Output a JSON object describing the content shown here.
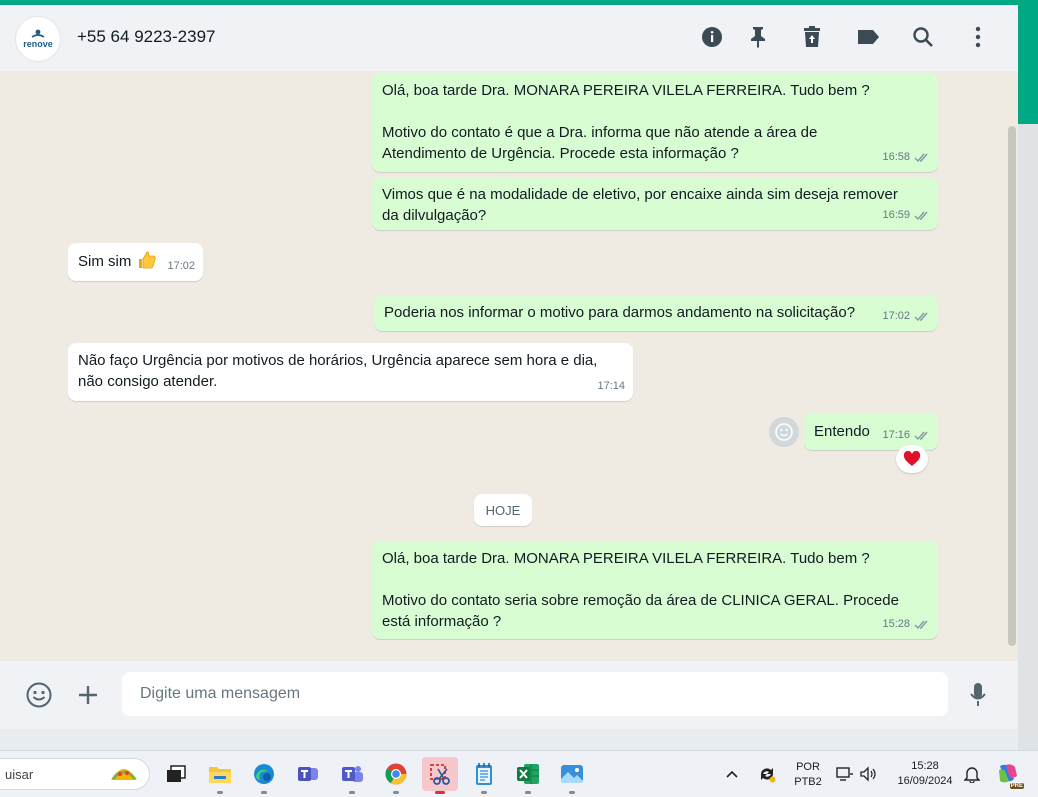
{
  "header": {
    "logo_text": "renove",
    "contact": "+55 64 9223-2397",
    "icons": [
      "info-icon",
      "pin-icon",
      "delete-icon",
      "label-icon",
      "search-icon",
      "menu-icon"
    ]
  },
  "messages": [
    {
      "dir": "out",
      "text": "Olá, boa tarde Dra. MONARA PEREIRA VILELA FERREIRA. Tudo bem ?\n\nMotivo do contato é que a Dra. informa que não atende a área de\nAtendimento de Urgência. Procede esta informação ?",
      "time": "16:58"
    },
    {
      "dir": "out",
      "text": "Vimos que é na modalidade de eletivo, por encaixe ainda sim deseja remover\nda dilvulgação?",
      "time": "16:59"
    },
    {
      "dir": "in",
      "text": "Sim sim",
      "time": "17:02"
    },
    {
      "dir": "out",
      "text": "Poderia nos informar o motivo para darmos andamento na solicitação?",
      "time": "17:02"
    },
    {
      "dir": "in",
      "text": "Não faço Urgência por motivos de horários, Urgência aparece sem hora e dia,\nnão consigo atender.",
      "time": "17:14"
    },
    {
      "dir": "out",
      "text": "Entendo",
      "time": "17:16"
    },
    {
      "dir": "out",
      "text": "Olá, boa tarde Dra. MONARA PEREIRA VILELA FERREIRA. Tudo bem ?\n\nMotivo do contato seria sobre remoção da área de CLINICA GERAL. Procede\nestá informação ?",
      "time": "15:28"
    }
  ],
  "date_divider": "HOJE",
  "composer": {
    "placeholder": "Digite uma mensagem"
  },
  "taskbar": {
    "search_text": "uisar",
    "apps": [
      "task-view",
      "file-explorer",
      "edge",
      "teams-classic",
      "teams",
      "chrome",
      "snipping-tool",
      "notepad",
      "excel",
      "photos"
    ],
    "lang": "POR",
    "layout": "PTB2",
    "time": "15:28",
    "date": "16/09/2024",
    "copilot_badge": "PRE"
  },
  "colors": {
    "accent": "#00a884",
    "outgoing": "#d9fdd3",
    "incoming": "#ffffff",
    "tick_read": "#8696a0"
  }
}
